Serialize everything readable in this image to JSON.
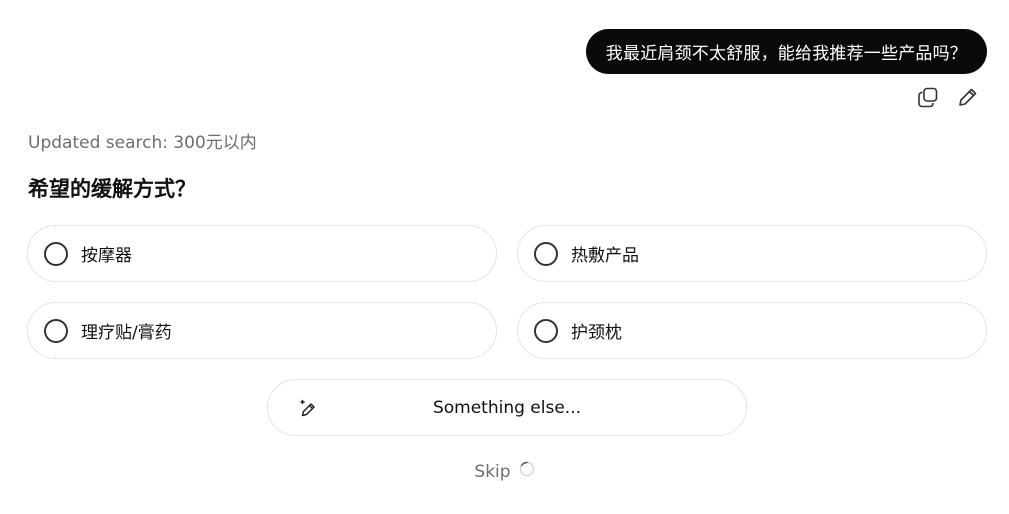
{
  "user_message": {
    "text": "我最近肩颈不太舒服，能给我推荐一些产品吗？",
    "actions": [
      {
        "icon": "copy-icon"
      },
      {
        "icon": "edit-pencil-icon"
      }
    ]
  },
  "updated_search": "Updated search: 300元以内",
  "question": {
    "title": "希望的缓解方式？",
    "options": [
      {
        "label": "按摩器",
        "selected": false
      },
      {
        "label": "热敷产品",
        "selected": false
      },
      {
        "label": "理疗贴/膏药",
        "selected": false
      },
      {
        "label": "护颈枕",
        "selected": false
      }
    ]
  },
  "something_else": {
    "label": "Something else...",
    "icon": "magic-pencil-icon"
  },
  "skip": {
    "label": "Skip",
    "icon": "loading-spinner-icon"
  },
  "colors": {
    "bubble_bg": "#0a0a0a",
    "bubble_text": "#ffffff",
    "muted_text": "#6e6e6e",
    "border": "#e4e4e4"
  }
}
